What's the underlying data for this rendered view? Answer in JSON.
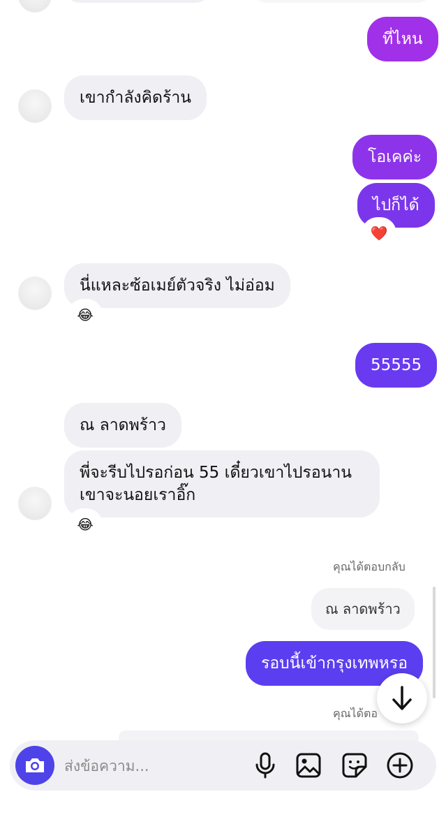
{
  "messages": {
    "m1": "ที่ไหน",
    "m2": "เขากำลังคิดร้าน",
    "m3": "โอเคค่ะ",
    "m4": "ไปก็ได้",
    "m5": "นี่แหละซ้อเมย์ตัวจริง ไม่อ่อม",
    "m6": "55555",
    "m7": "ณ ลาดพร้าว",
    "m8_line1": "พี่จะรีบไปรอก่อน 55 เดี๋ยวเขาไปรอนาน",
    "m8_line2": "เขาจะนอยเราอิ๊ก",
    "reply_label_1": "คุณได้ตอบกลับ",
    "reply_quote_1": "ณ ลาดพร้าว",
    "m9": "รอบนี้เข้ากรุงเทพหรอ",
    "reply_label_2": "คุณได้ตอ"
  },
  "reactions": {
    "heart": "❤️",
    "laugh": "😂"
  },
  "composer": {
    "placeholder": "ส่งข้อความ..."
  },
  "icons": {
    "camera": "camera-icon",
    "mic": "microphone-icon",
    "gallery": "gallery-icon",
    "sticker": "sticker-icon",
    "plus": "plus-icon",
    "scroll_down": "arrow-down-icon"
  },
  "colors": {
    "incoming_bubble": "#efeff4",
    "outgoing_gradient_top": "#a031e8",
    "outgoing_gradient_bottom": "#5b3ef0",
    "camera_button": "#4e43e8"
  }
}
